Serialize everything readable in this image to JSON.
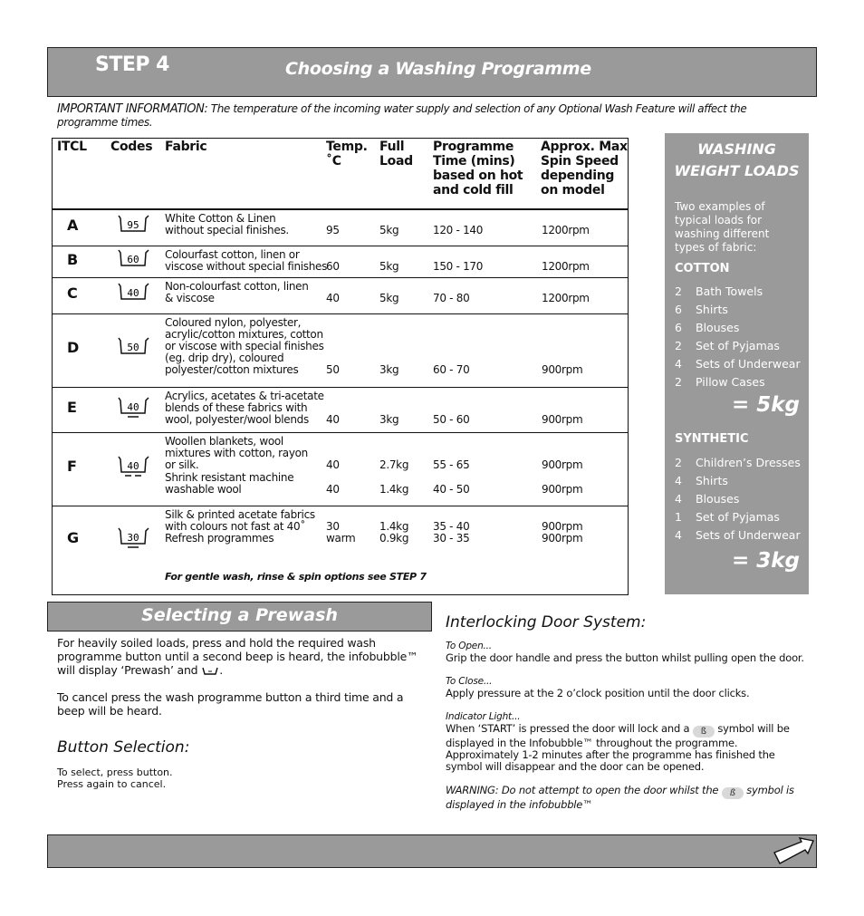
{
  "header": {
    "step": "STEP 4",
    "title": "Choosing a Washing Programme"
  },
  "important": {
    "lead": "IMPORTANT INFORMATION:",
    "text": "The temperature of the incoming water supply and selection of any Optional Wash Feature will affect the programme times."
  },
  "table": {
    "columns": {
      "itcl": "ITCL",
      "codes": "Codes",
      "fabric": "Fabric",
      "temp": "Temp. ˚C",
      "load": "Full Load",
      "time": "Programme Time (mins) based on hot and cold fill",
      "spin": "Approx. Max Spin Speed depending on model"
    },
    "rows": [
      {
        "code": "A",
        "symbol_temp": "95",
        "underlines": 0,
        "lines": [
          {
            "fabric": "White Cotton & Linen\nwithout special finishes.",
            "temp": "95",
            "load": "5kg",
            "time": "120 - 140",
            "spin": "1200rpm"
          }
        ]
      },
      {
        "code": "B",
        "symbol_temp": "60",
        "underlines": 0,
        "lines": [
          {
            "fabric": "Colourfast cotton, linen or\nviscose without special finishes",
            "temp": "60",
            "load": "5kg",
            "time": "150 - 170",
            "spin": "1200rpm"
          }
        ]
      },
      {
        "code": "C",
        "symbol_temp": "40",
        "underlines": 0,
        "lines": [
          {
            "fabric": "Non-colourfast cotton, linen\n& viscose",
            "temp": "40",
            "load": "5kg",
            "time": "70 - 80",
            "spin": "1200rpm"
          }
        ]
      },
      {
        "code": "D",
        "symbol_temp": "50",
        "underlines": 0,
        "lines": [
          {
            "fabric": "Coloured nylon, polyester,\nacrylic/cotton mixtures, cotton\nor viscose with special finishes\n(eg. drip dry), coloured\npolyester/cotton mixtures",
            "temp": "50",
            "load": "3kg",
            "time": "60 - 70",
            "spin": "900rpm"
          }
        ]
      },
      {
        "code": "E",
        "symbol_temp": "40",
        "underlines": 1,
        "lines": [
          {
            "fabric": "Acrylics, acetates & tri-acetate\nblends of these fabrics with\nwool, polyester/wool blends",
            "temp": "40",
            "load": "3kg",
            "time": "50 - 60",
            "spin": "900rpm"
          }
        ]
      },
      {
        "code": "F",
        "symbol_temp": "40",
        "underlines": 2,
        "lines": [
          {
            "fabric": "Woollen blankets, wool\nmixtures with cotton, rayon\nor silk.",
            "temp": "40",
            "load": "2.7kg",
            "time": "55 - 65",
            "spin": "900rpm"
          },
          {
            "fabric": "Shrink resistant machine\nwashable wool",
            "temp": "40",
            "load": "1.4kg",
            "time": "40 - 50",
            "spin": "900rpm"
          }
        ]
      },
      {
        "code": "G",
        "symbol_temp": "30",
        "underlines": 1,
        "lines": [
          {
            "fabric": "Silk & printed acetate fabrics\nwith colours not fast at 40˚",
            "temp": "30",
            "load": "1.4kg",
            "time": "35 - 40",
            "spin": "900rpm"
          },
          {
            "fabric": "Refresh programmes",
            "temp": "warm",
            "load": "0.9kg",
            "time": "30 - 35",
            "spin": "900rpm"
          }
        ]
      }
    ],
    "note": "For gentle wash, rinse & spin options see STEP 7"
  },
  "weights": {
    "title": "WASHING WEIGHT LOADS",
    "intro": "Two examples of typical loads for washing different types of fabric:",
    "groups": [
      {
        "name": "COTTON",
        "total": "= 5kg",
        "items": [
          {
            "qty": "2",
            "item": "Bath Towels"
          },
          {
            "qty": "6",
            "item": "Shirts"
          },
          {
            "qty": "6",
            "item": "Blouses"
          },
          {
            "qty": "2",
            "item": "Set of Pyjamas"
          },
          {
            "qty": "4",
            "item": "Sets of Underwear"
          },
          {
            "qty": "2",
            "item": "Pillow Cases"
          }
        ]
      },
      {
        "name": "SYNTHETIC",
        "total": "= 3kg",
        "items": [
          {
            "qty": "2",
            "item": "Children’s Dresses"
          },
          {
            "qty": "4",
            "item": "Shirts"
          },
          {
            "qty": "4",
            "item": "Blouses"
          },
          {
            "qty": "1",
            "item": "Set of Pyjamas"
          },
          {
            "qty": "4",
            "item": "Sets of Underwear"
          }
        ]
      }
    ]
  },
  "prewash": {
    "title": "Selecting a Prewash",
    "p1_before": "For heavily soiled loads, press and hold the required wash programme button until a second beep is heard, the infobubble™ will display ‘Prewash’ and",
    "p1_after": ".",
    "p2": "To cancel press the wash programme button a third time and a beep will be heard."
  },
  "button_selection": {
    "title": "Button Selection:",
    "line1": "To select, press button.",
    "line2": "Press again to cancel."
  },
  "door": {
    "title": "Interlocking Door System:",
    "open_label": "To Open...",
    "open_text": "Grip the door handle and press the button whilst pulling open the door.",
    "close_label": "To Close...",
    "close_text": "Apply pressure at the 2 o’clock position until the door clicks.",
    "indicator_label": "Indicator Light...",
    "indicator_before": "When ‘START’ is pressed the door will lock and a",
    "indicator_after": "symbol will be displayed in the Infobubble™ throughout the programme. Approximately 1-2 minutes after the programme has finished the symbol will disappear and the door can be opened.",
    "warning_before": "WARNING: Do not attempt to open the door whilst the",
    "warning_after": "symbol is displayed in the infobubble™",
    "lock_symbol": "ß"
  },
  "footer": {
    "next_icon": "next-page-arrow"
  }
}
